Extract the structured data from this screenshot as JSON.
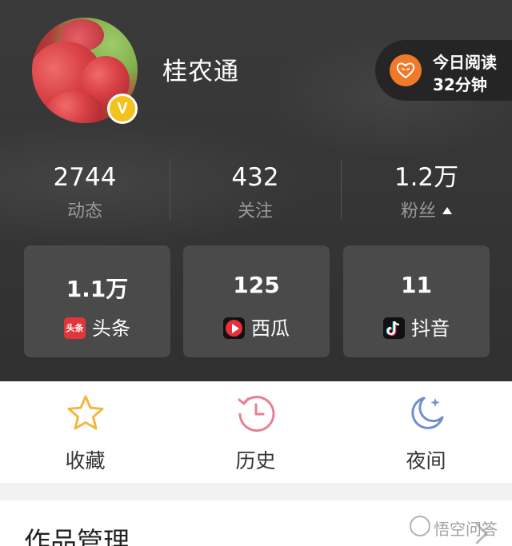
{
  "profile": {
    "username": "桂农通",
    "verified_badge": "V",
    "avatar_icon": "lychee-avatar"
  },
  "reading": {
    "line1": "今日阅读",
    "line2": "32分钟",
    "icon": "heart-book-icon",
    "accent": "#f17a2a"
  },
  "stats": [
    {
      "value": "2744",
      "label": "动态"
    },
    {
      "value": "432",
      "label": "关注"
    },
    {
      "value": "1.2万",
      "label": "粉丝"
    }
  ],
  "platforms": [
    {
      "value": "1.1万",
      "label": "头条",
      "icon_text": "头条",
      "icon": "toutiao-icon"
    },
    {
      "value": "125",
      "label": "西瓜",
      "icon": "xigua-icon"
    },
    {
      "value": "11",
      "label": "抖音",
      "icon": "douyin-icon"
    }
  ],
  "tools": [
    {
      "label": "收藏",
      "icon": "star-icon",
      "color": "#f4b63f"
    },
    {
      "label": "历史",
      "icon": "history-clock-icon",
      "color": "#e87f95"
    },
    {
      "label": "夜间",
      "icon": "moon-icon",
      "color": "#6f8fcf"
    }
  ],
  "works": {
    "title": "作品管理"
  },
  "watermark": "悟空问答"
}
